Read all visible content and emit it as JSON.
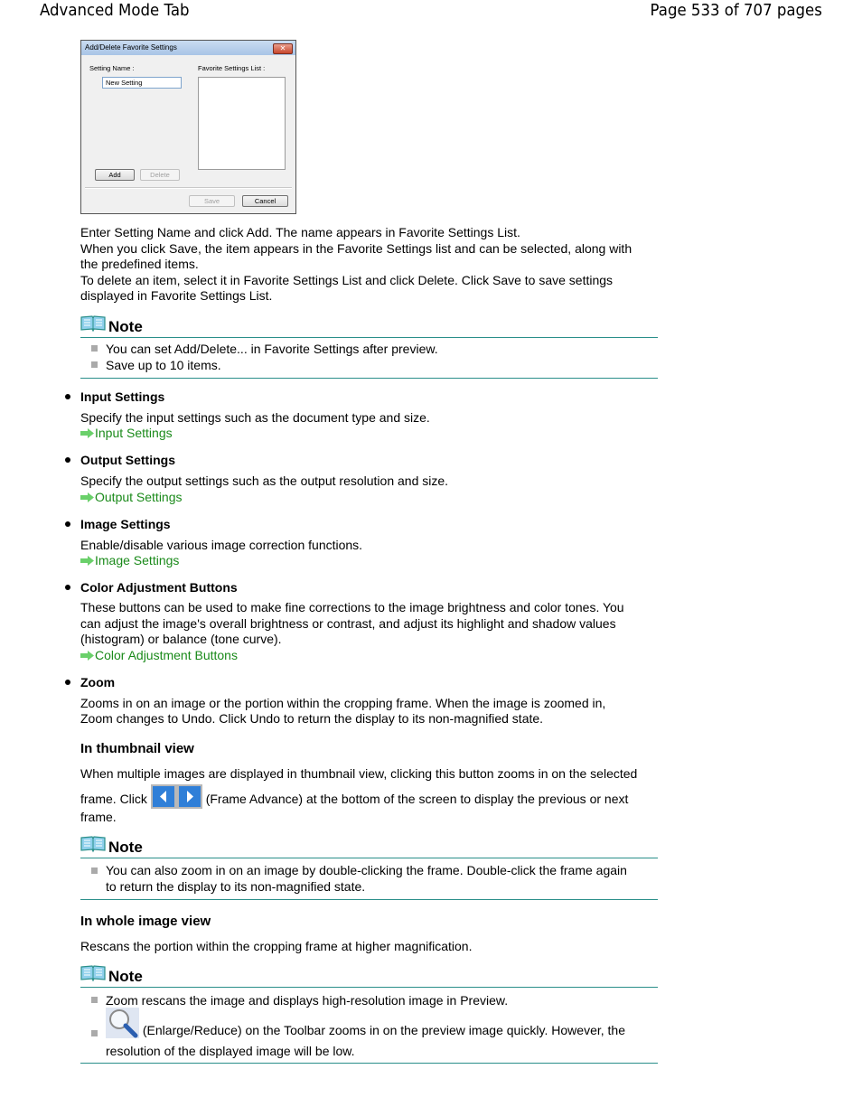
{
  "header": {
    "title": "Advanced Mode Tab",
    "page": "Page 533 of 707 pages"
  },
  "dialog": {
    "title": "Add/Delete Favorite Settings",
    "setting_name_label": "Setting Name :",
    "setting_name_value": "New Setting",
    "list_label": "Favorite Settings List :",
    "add": "Add",
    "delete": "Delete",
    "save": "Save",
    "cancel": "Cancel"
  },
  "intro": [
    "Enter Setting Name and click Add. The name appears in Favorite Settings List.",
    "When you click Save, the item appears in the Favorite Settings list and can be selected, along with",
    "the predefined items.",
    "To delete an item, select it in Favorite Settings List and click Delete. Click Save to save settings",
    "displayed in Favorite Settings List."
  ],
  "note_label": "Note",
  "note1": [
    "You can set Add/Delete... in Favorite Settings after preview.",
    "Save up to 10 items."
  ],
  "sections": [
    {
      "title": "Input Settings",
      "lines": [
        "Specify the input settings such as the document type and size."
      ],
      "link": "Input Settings"
    },
    {
      "title": "Output Settings",
      "lines": [
        "Specify the output settings such as the output resolution and size."
      ],
      "link": "Output Settings"
    },
    {
      "title": "Image Settings",
      "lines": [
        "Enable/disable various image correction functions."
      ],
      "link": "Image Settings"
    },
    {
      "title": "Color Adjustment Buttons",
      "lines": [
        "These buttons can be used to make fine corrections to the image brightness and color tones. You",
        "can adjust the image's overall brightness or contrast, and adjust its highlight and shadow values",
        "(histogram) or balance (tone curve)."
      ],
      "link": "Color Adjustment Buttons"
    },
    {
      "title": "Zoom",
      "lines": [
        "Zooms in on an image or the portion within the cropping frame. When the image is zoomed in,",
        "Zoom changes to Undo. Click Undo to return the display to its non-magnified state."
      ]
    }
  ],
  "thumb": {
    "heading": "In thumbnail view",
    "line1": "When multiple images are displayed in thumbnail view, clicking this button zooms in on the selected",
    "line2a": "frame. Click",
    "line2b": "(Frame Advance) at the bottom of the screen to display the previous or next",
    "line3": "frame.",
    "note": [
      "You can also zoom in on an image by double-clicking the frame. Double-click the frame again",
      "to return the display to its non-magnified state."
    ]
  },
  "whole": {
    "heading": "In whole image view",
    "line1": "Rescans the portion within the cropping frame at higher magnification.",
    "note1": "Zoom rescans the image and displays high-resolution image in Preview.",
    "note2a": "(Enlarge/Reduce) on the Toolbar zooms in on the preview image quickly. However, the",
    "note2b": "resolution of the displayed image will be low."
  },
  "colors": {
    "link": "#1a8a1a",
    "rule": "#2a8f8a"
  }
}
